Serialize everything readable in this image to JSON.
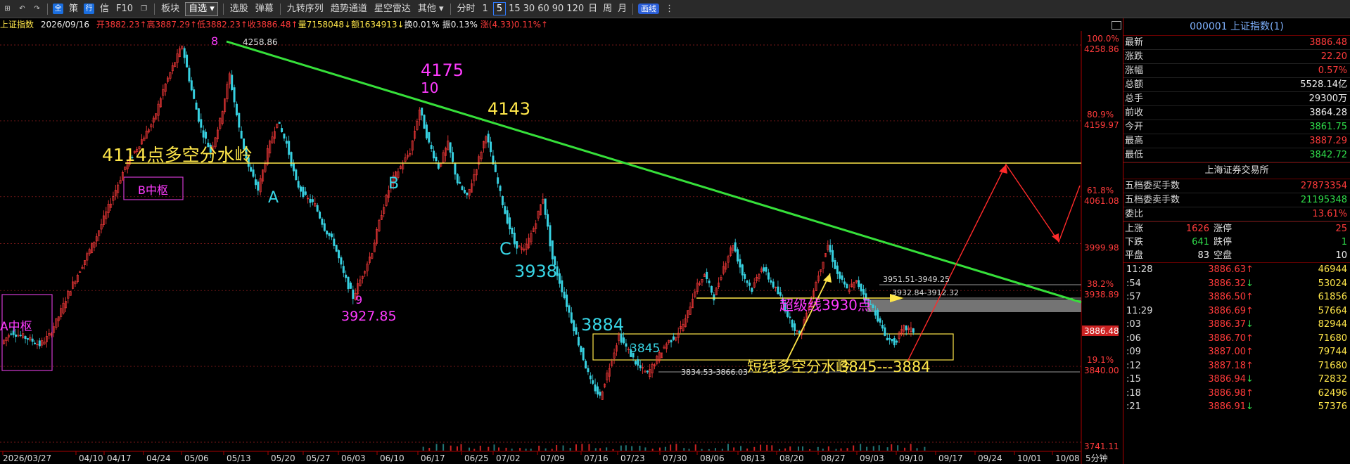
{
  "toolbar": {
    "icon_all": "全",
    "items_left": [
      "策",
      "行",
      "信",
      "F10"
    ],
    "board": "板块",
    "watchlist": "自选",
    "items_mid": [
      "选股",
      "弹幕",
      "九转序列",
      "趋势通道",
      "星空雷达",
      "其他"
    ],
    "period_label": "分时",
    "periods": [
      "1",
      "5",
      "15",
      "30",
      "60",
      "90",
      "120",
      "日",
      "周",
      "月"
    ],
    "active_period": "5",
    "draw_badge": "画线"
  },
  "infobar": {
    "name": "上证指数",
    "date": "2026/09/16",
    "open": "开3882.23↑",
    "high": "高3887.29↑",
    "low": "低3882.23↑",
    "close": "收3886.48↑",
    "volume": "量7158048↓",
    "amount": "额1634913↓",
    "turnover": "换0.01%",
    "amplitude": "振0.13%",
    "change": "涨(4.33)0.11%↑"
  },
  "chart_data": {
    "type": "candlestick",
    "timeframe_label": "5分钟",
    "x_ticks": [
      "2026/03/27",
      "04/10",
      "04/17",
      "04/24",
      "05/06",
      "05/13",
      "05/20",
      "05/27",
      "06/03",
      "06/10",
      "06/17",
      "06/25",
      "07/02",
      "07/09",
      "07/16",
      "07/23",
      "07/30",
      "08/06",
      "08/13",
      "08/20",
      "08/27",
      "09/03",
      "09/10",
      "09/17",
      "09/24",
      "10/01",
      "10/08"
    ],
    "y_levels": [
      {
        "pct": "100.0%",
        "price": "4258.86"
      },
      {
        "pct": "80.9%",
        "price": "4159.97"
      },
      {
        "pct": "61.8%",
        "price": "4061.08"
      },
      {
        "price": "3999.98"
      },
      {
        "pct": "38.2%",
        "price": "3938.89"
      },
      {
        "pct": "19.1%",
        "price": "3840.00"
      },
      {
        "price": "3741.11"
      }
    ],
    "last_price_tag": "3886.48",
    "price_path": [
      3870,
      3885,
      3880,
      3875,
      3868,
      3880,
      3905,
      3935,
      3960,
      3985,
      4010,
      4040,
      4070,
      4100,
      4120,
      4140,
      4160,
      4200,
      4230,
      4258,
      4200,
      4150,
      4120,
      4160,
      4220,
      4150,
      4100,
      4070,
      4120,
      4160,
      4130,
      4080,
      4060,
      4050,
      4020,
      4000,
      3960,
      3930,
      3960,
      3990,
      4040,
      4080,
      4100,
      4120,
      4175,
      4130,
      4100,
      4130,
      4080,
      4060,
      4100,
      4143,
      4090,
      4040,
      4000,
      3990,
      4020,
      4060,
      3980,
      3940,
      3900,
      3860,
      3820,
      3800,
      3840,
      3880,
      3860,
      3840,
      3830,
      3850,
      3870,
      3880,
      3900,
      3940,
      3960,
      3930,
      3970,
      4000,
      3960,
      3940,
      3970,
      3950,
      3930,
      3900,
      3880,
      3920,
      3960,
      3998,
      3960,
      3940,
      3950,
      3930,
      3910,
      3880,
      3870,
      3890,
      3886
    ],
    "annotations": [
      "8",
      "4258.86",
      "4175",
      "10",
      "4143",
      "4114点多空分水岭",
      "B中枢",
      "A",
      "B",
      "9",
      "3927.85",
      "C",
      "3938",
      "3884",
      "3845",
      "3834.53-3866.03",
      "短线多空分水岭",
      "3845---3884",
      "超级线3930点",
      "3951.51-3949.25",
      "3932.84-3912.32",
      "A中枢"
    ]
  },
  "quote": {
    "title": "000001 上证指数(1)",
    "rows": [
      {
        "label": "最新",
        "value": "3886.48",
        "color": "red"
      },
      {
        "label": "涨跌",
        "value": "22.20",
        "color": "red"
      },
      {
        "label": "涨幅",
        "value": "0.57%",
        "color": "red"
      },
      {
        "label": "总额",
        "value": "5528.14亿",
        "color": "white"
      },
      {
        "label": "总手",
        "value": "29300万",
        "color": "white"
      },
      {
        "label": "前收",
        "value": "3864.28",
        "color": "white"
      },
      {
        "label": "今开",
        "value": "3861.75",
        "color": "green"
      },
      {
        "label": "最高",
        "value": "3887.29",
        "color": "red"
      },
      {
        "label": "最低",
        "value": "3842.72",
        "color": "green"
      }
    ],
    "exchange": "上海证券交易所",
    "rows2": [
      {
        "label": "五档委买手数",
        "value": "27873354",
        "color": "red"
      },
      {
        "label": "五档委卖手数",
        "value": "21195348",
        "color": "green"
      },
      {
        "label": "委比",
        "value": "13.61%",
        "color": "red"
      }
    ],
    "breadth": [
      {
        "l1": "上涨",
        "v1": "1626",
        "c1": "red",
        "l2": "涨停",
        "v2": "25",
        "c2": "red"
      },
      {
        "l1": "下跌",
        "v1": "641",
        "c1": "green",
        "l2": "跌停",
        "v2": "1",
        "c2": "green"
      },
      {
        "l1": "平盘",
        "v1": "83",
        "c1": "white",
        "l2": "空盘",
        "v2": "10",
        "c2": "white"
      }
    ],
    "ticks": [
      {
        "time": "11:28",
        "price": "3886.63",
        "dir": "↑",
        "vol": "46944"
      },
      {
        "time": ":54",
        "price": "3886.32",
        "dir": "↓",
        "vol": "53024"
      },
      {
        "time": ":57",
        "price": "3886.50",
        "dir": "↑",
        "vol": "61856"
      },
      {
        "time": "11:29",
        "price": "3886.69",
        "dir": "↑",
        "vol": "57664"
      },
      {
        "time": ":03",
        "price": "3886.37",
        "dir": "↓",
        "vol": "82944"
      },
      {
        "time": ":06",
        "price": "3886.70",
        "dir": "↑",
        "vol": "71680"
      },
      {
        "time": ":09",
        "price": "3887.00",
        "dir": "↑",
        "vol": "79744"
      },
      {
        "time": ":12",
        "price": "3887.18",
        "dir": "↑",
        "vol": "71680"
      },
      {
        "time": ":15",
        "price": "3886.94",
        "dir": "↓",
        "vol": "72832"
      },
      {
        "time": ":18",
        "price": "3886.98",
        "dir": "↑",
        "vol": "62496"
      },
      {
        "time": ":21",
        "price": "3886.91",
        "dir": "↓",
        "vol": "57376"
      }
    ]
  }
}
